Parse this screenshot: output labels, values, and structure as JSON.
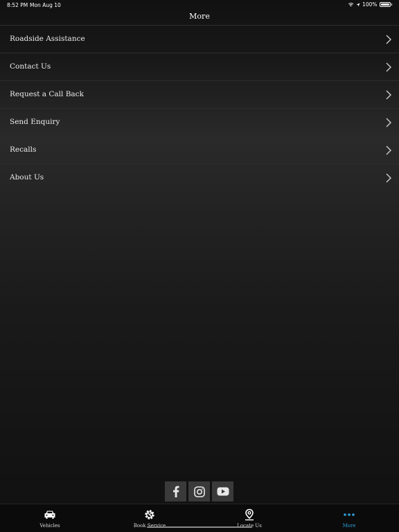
{
  "status_bar": {
    "time": "8:52 PM",
    "date": "Mon Aug 10",
    "battery": "100%"
  },
  "nav": {
    "title": "More"
  },
  "menu": {
    "items": [
      {
        "label": "Roadside Assistance"
      },
      {
        "label": "Contact Us"
      },
      {
        "label": "Request a Call Back"
      },
      {
        "label": "Send Enquiry"
      },
      {
        "label": "Recalls"
      },
      {
        "label": "About Us"
      }
    ]
  },
  "social": [
    "facebook-icon",
    "instagram-icon",
    "youtube-icon"
  ],
  "tabs": [
    {
      "label": "Vehicles",
      "icon": "car-icon"
    },
    {
      "label": "Book Service",
      "icon": "service-gear-icon"
    },
    {
      "label": "Locate Us",
      "icon": "location-pin-icon"
    },
    {
      "label": "More",
      "icon": "more-dots-icon"
    }
  ],
  "colors": {
    "accent": "#2f9fd8",
    "background": "#121212"
  }
}
